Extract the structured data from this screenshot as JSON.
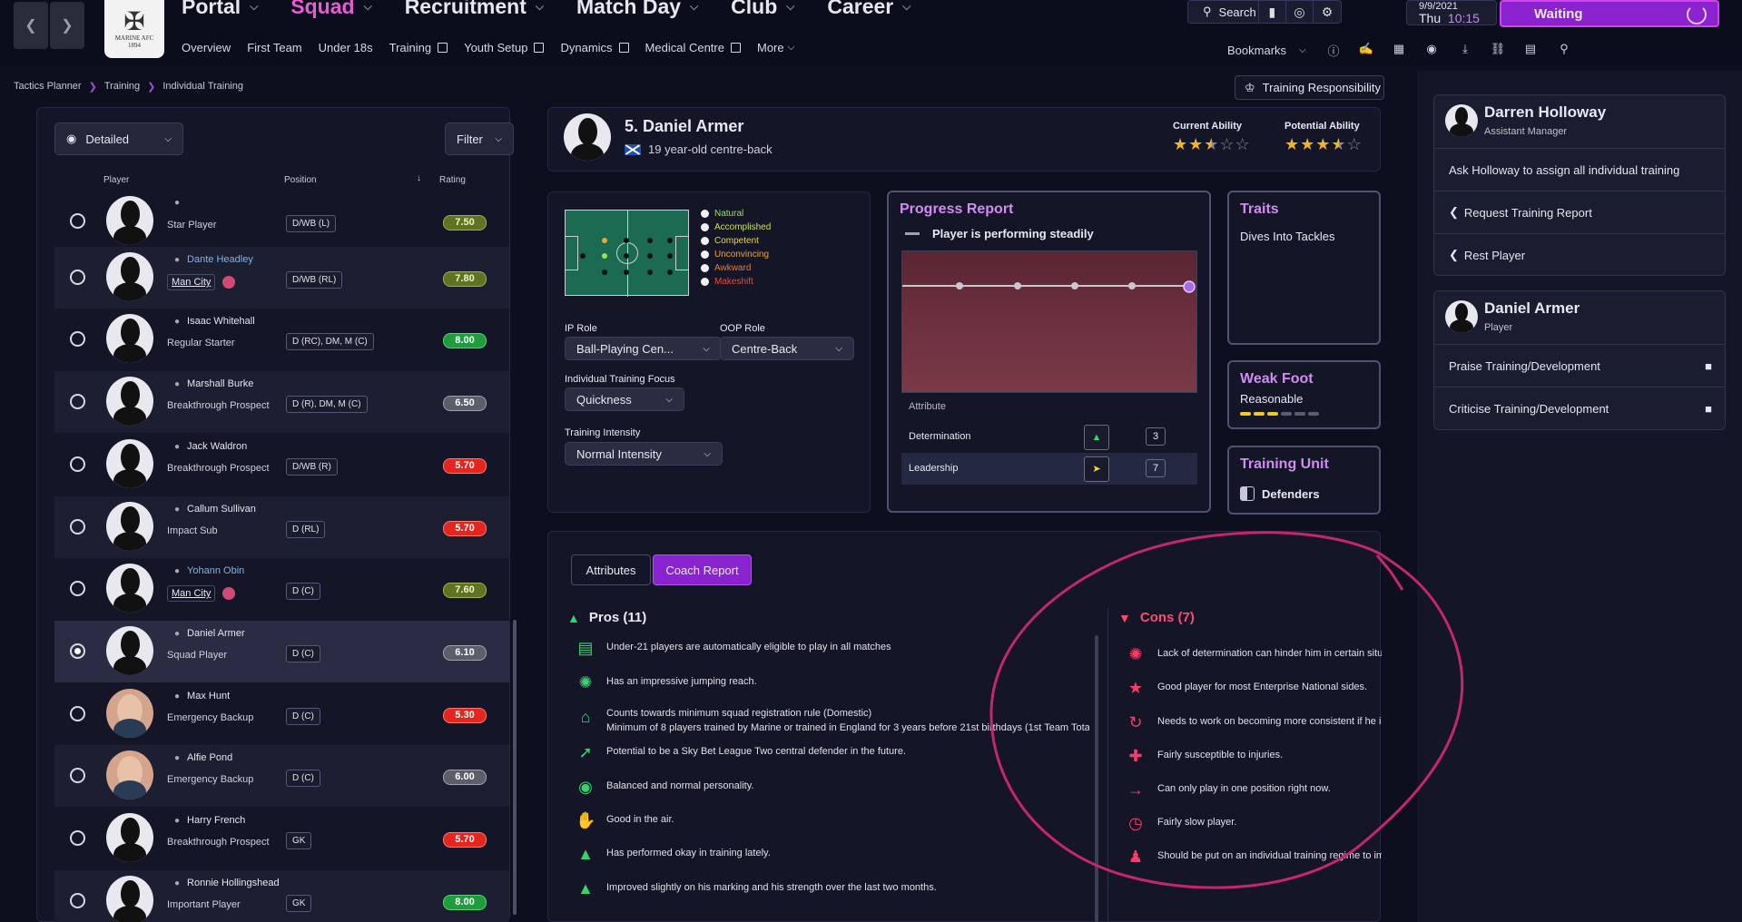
{
  "nav": {
    "items": [
      {
        "label": "Portal"
      },
      {
        "label": "Squad"
      },
      {
        "label": "Recruitment"
      },
      {
        "label": "Match Day"
      },
      {
        "label": "Club"
      },
      {
        "label": "Career"
      }
    ],
    "sub_items": [
      "Overview",
      "First Team",
      "Under 18s",
      "Training",
      "Youth Setup",
      "Dynamics",
      "Medical Centre",
      "More"
    ],
    "crest_motto": "MARINE AFC",
    "crest_year": "1894",
    "search_label": "Search",
    "date_top": "9/9/2021",
    "day": "Thu",
    "time": "10:15",
    "waiting_label": "Waiting",
    "bookmarks_label": "Bookmarks"
  },
  "breadcrumb": [
    "Tactics Planner",
    "Training",
    "Individual Training"
  ],
  "responsibility_label": "Training Responsibility",
  "list": {
    "view_label": "Detailed",
    "filter_label": "Filter",
    "col_player": "Player",
    "col_position": "Position",
    "col_rating": "Rating",
    "rows": [
      {
        "name": "",
        "role": "Star Player",
        "position": "D/WB (L)",
        "rating": "7.50",
        "rating_class": "olive",
        "club": false
      },
      {
        "name": "Dante Headley",
        "role": "Man City",
        "position": "D/WB (RL)",
        "rating": "7.80",
        "rating_class": "olive",
        "club": true
      },
      {
        "name": "Isaac Whitehall",
        "role": "Regular Starter",
        "position": "D (RC), DM, M (C)",
        "rating": "8.00",
        "rating_class": "green",
        "club": false
      },
      {
        "name": "Marshall Burke",
        "role": "Breakthrough Prospect",
        "position": "D (R), DM, M (C)",
        "rating": "6.50",
        "rating_class": "grey",
        "club": false
      },
      {
        "name": "Jack Waldron",
        "role": "Breakthrough Prospect",
        "position": "D/WB (R)",
        "rating": "5.70",
        "rating_class": "red",
        "club": false
      },
      {
        "name": "Callum Sullivan",
        "role": "Impact Sub",
        "position": "D (RL)",
        "rating": "5.70",
        "rating_class": "red",
        "club": false
      },
      {
        "name": "Yohann Obin",
        "role": "Man City",
        "position": "D (C)",
        "rating": "7.60",
        "rating_class": "olive",
        "club": true
      },
      {
        "name": "Daniel Armer",
        "role": "Squad Player",
        "position": "D (C)",
        "rating": "6.10",
        "rating_class": "grey",
        "club": false
      },
      {
        "name": "Max Hunt",
        "role": "Emergency Backup",
        "position": "D (C)",
        "rating": "5.30",
        "rating_class": "red",
        "club": false
      },
      {
        "name": "Alfie Pond",
        "role": "Emergency Backup",
        "position": "D (C)",
        "rating": "6.00",
        "rating_class": "grey",
        "club": false
      },
      {
        "name": "Harry French",
        "role": "Breakthrough Prospect",
        "position": "GK",
        "rating": "5.70",
        "rating_class": "red",
        "club": false
      },
      {
        "name": "Ronnie Hollingshead",
        "role": "Important Player",
        "position": "GK",
        "rating": "8.00",
        "rating_class": "green",
        "club": false
      }
    ]
  },
  "player": {
    "title": "5. Daniel Armer",
    "subtitle": "19 year-old centre-back",
    "current_ability_label": "Current Ability",
    "potential_ability_label": "Potential Ability",
    "current_stars": 2.5,
    "potential_stars": 3.5
  },
  "legend": [
    {
      "label": "Natural",
      "color": "#9be05a"
    },
    {
      "label": "Accomplished",
      "color": "#c9e04a"
    },
    {
      "label": "Competent",
      "color": "#e8d24a"
    },
    {
      "label": "Unconvincing",
      "color": "#e8a73a"
    },
    {
      "label": "Awkward",
      "color": "#e87a3a"
    },
    {
      "label": "Makeshift",
      "color": "#e84a3a"
    }
  ],
  "roles": {
    "ip_label": "IP Role",
    "ip_value": "Ball-Playing Cen...",
    "oop_label": "OOP Role",
    "oop_value": "Centre-Back",
    "focus_label": "Individual Training Focus",
    "focus_value": "Quickness",
    "intensity_label": "Training Intensity",
    "intensity_value": "Normal Intensity"
  },
  "progress": {
    "title": "Progress Report",
    "status": "Player is performing steadily",
    "attr_header": "Attribute",
    "attrs": [
      {
        "name": "Determination",
        "value": "3"
      },
      {
        "name": "Leadership",
        "value": "7"
      }
    ]
  },
  "traits": {
    "title": "Traits",
    "value": "Dives Into Tackles"
  },
  "weakfoot": {
    "title": "Weak Foot",
    "value": "Reasonable",
    "level": 3
  },
  "unit": {
    "title": "Training Unit",
    "value": "Defenders"
  },
  "report": {
    "tab_attributes": "Attributes",
    "tab_coach": "Coach Report",
    "pros_title": "Pros (11)",
    "cons_title": "Cons (7)",
    "pros": [
      "Under-21 players are automatically eligible to play in all matches",
      "Has an impressive jumping reach.",
      "Counts towards minimum squad registration rule (Domestic)",
      "Potential to be a Sky Bet League Two central defender in the future.",
      "Balanced and normal personality.",
      "Good in the air.",
      "Has performed okay in training lately.",
      "Improved slightly on his marking and his strength over the last two months."
    ],
    "pros_sub": "Minimum of 8 players trained by Marine or trained in England for 3 years before 21st birthdays (1st Team Total...",
    "cons": [
      "Lack of determination can hinder him in certain situ",
      "Good player for most Enterprise National sides.",
      "Needs to work on becoming more consistent if he is",
      "Fairly susceptible to injuries.",
      "Can only play in one position right now.",
      "Fairly slow player.",
      "Should be put on an individual training regime to im"
    ]
  },
  "staff": {
    "name": "Darren Holloway",
    "role": "Assistant Manager",
    "actions": [
      "Ask Holloway to assign all individual training",
      "Request Training Report",
      "Rest Player"
    ]
  },
  "player_card": {
    "name": "Daniel Armer",
    "role": "Player",
    "actions": [
      "Praise Training/Development",
      "Criticise Training/Development"
    ]
  }
}
